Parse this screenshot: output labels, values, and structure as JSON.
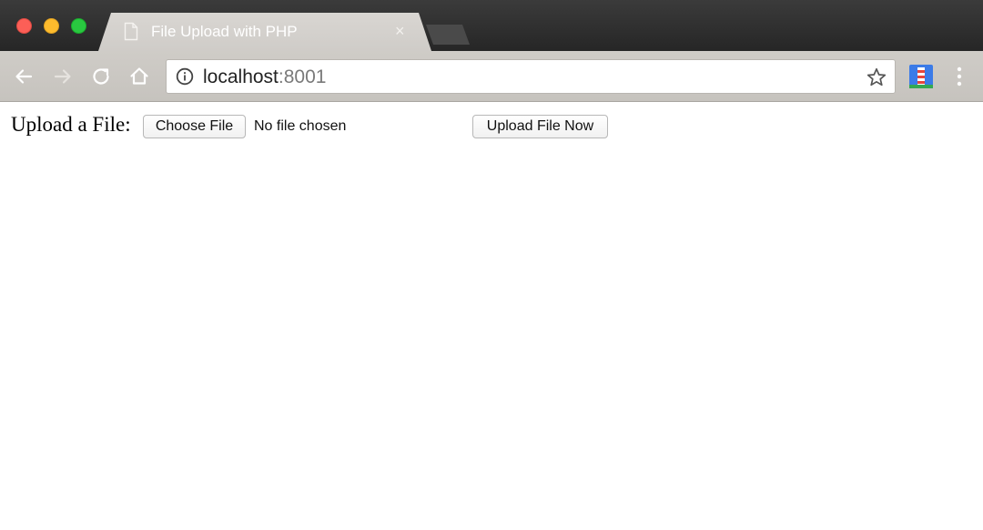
{
  "window": {
    "colors": {
      "close": "#fc5f57",
      "minimize": "#fdbb2d",
      "zoom": "#29c840"
    }
  },
  "tab": {
    "title": "File Upload with PHP",
    "close_glyph": "×",
    "icon": "document-icon"
  },
  "toolbar": {
    "back_icon": "back-arrow-icon",
    "forward_icon": "forward-arrow-icon",
    "reload_icon": "reload-icon",
    "home_icon": "home-icon",
    "menu_icon": "vertical-dots-icon"
  },
  "address_bar": {
    "host": "localhost",
    "port": ":8001",
    "info_icon": "info-icon",
    "bookmark_icon": "star-icon"
  },
  "page": {
    "label": "Upload a File:",
    "choose_button": "Choose File",
    "file_status": "No file chosen",
    "submit_button": "Upload File Now"
  }
}
